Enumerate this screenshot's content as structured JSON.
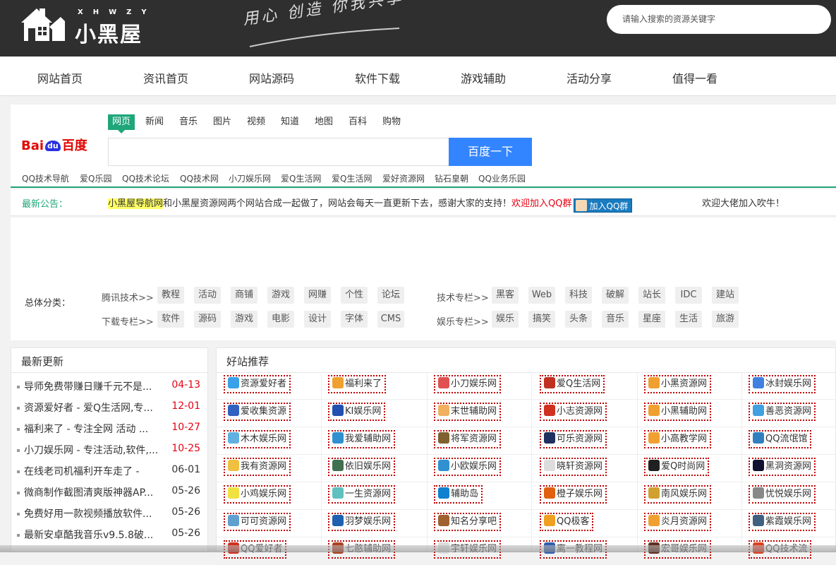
{
  "header": {
    "logo_letters": "XHWZY",
    "logo_text": "小黑屋",
    "slogan": "用心 创造 你我共享",
    "search_placeholder": "请输入搜索的资源关键字"
  },
  "nav": {
    "items": [
      "网站首页",
      "资讯首页",
      "网站源码",
      "软件下载",
      "游戏辅助",
      "活动分享",
      "值得一看"
    ]
  },
  "baidu": {
    "logo_bai": "Bai",
    "logo_du": "du",
    "logo_zh": "百度",
    "tabs": [
      "网页",
      "新闻",
      "音乐",
      "图片",
      "视频",
      "知道",
      "地图",
      "百科",
      "购物"
    ],
    "button": "百度一下",
    "links": [
      "QQ技术导航",
      "爱Q乐园",
      "QQ技术论坛",
      "QQ技术网",
      "小刀娱乐网",
      "爱Q生活网",
      "爱Q生活网",
      "爱好资源网",
      "钻石皇朝",
      "QQ业务乐园"
    ]
  },
  "notice": {
    "label": "最新公告：",
    "highlight": "小黑屋导航网",
    "text": "和小黑屋资源网两个网站合成一起做了，网站会每天一直更新下去，感谢大家的支持！",
    "red": "欢迎加入QQ群",
    "qq_button": "加入QQ群",
    "right": "欢迎大佬加入吹牛！"
  },
  "categories": {
    "label": "总体分类：",
    "groups": [
      {
        "name": "腾讯技术>>",
        "tags": [
          "教程",
          "活动",
          "商铺",
          "游戏",
          "网赚",
          "个性",
          "论坛"
        ]
      },
      {
        "name": "技术专栏>>",
        "tags": [
          "黑客",
          "Web",
          "科技",
          "破解",
          "站长",
          "IDC",
          "建站"
        ]
      },
      {
        "name": "下载专栏>>",
        "tags": [
          "软件",
          "源码",
          "游戏",
          "电影",
          "设计",
          "字体",
          "CMS"
        ]
      },
      {
        "name": "娱乐专栏>>",
        "tags": [
          "娱乐",
          "搞笑",
          "头条",
          "音乐",
          "星座",
          "生活",
          "旅游"
        ]
      }
    ]
  },
  "latest": {
    "title": "最新更新",
    "items": [
      {
        "title": "导师免费带赚日赚千元不是...",
        "date": "04-13",
        "recent": true
      },
      {
        "title": "资源爱好者 - 爱Q生活网,专...",
        "date": "12-01",
        "recent": true
      },
      {
        "title": "福利来了 - 专注全网 活动 ...",
        "date": "10-27",
        "recent": true
      },
      {
        "title": "小刀娱乐网 - 专注活动,软件,...",
        "date": "10-25",
        "recent": true
      },
      {
        "title": "在线老司机福利开车走了 -",
        "date": "06-01",
        "recent": false
      },
      {
        "title": "微商制作截图清爽版神器AP...",
        "date": "05-26",
        "recent": false
      },
      {
        "title": "免费好用一款视频播放软件...",
        "date": "05-26",
        "recent": false
      },
      {
        "title": "最新安卓酷我音乐v9.5.8破...",
        "date": "05-26",
        "recent": false
      }
    ]
  },
  "good": {
    "title": "好站推荐",
    "rows": [
      [
        "资源爱好者",
        "福利来了",
        "小刀娱乐网",
        "爱Q生活网",
        "小黑资源网",
        "冰封娱乐网"
      ],
      [
        "爱收集资源",
        "KI娱乐网",
        "末世辅助网",
        "小志资源网",
        "小黑辅助网",
        "善恶资源网"
      ],
      [
        "木木娱乐网",
        "我爱辅助网",
        "将军资源网",
        "可乐资源网",
        "小高教学网",
        "QQ流氓馆"
      ],
      [
        "我有资源网",
        "依旧娱乐网",
        "小欧娱乐网",
        "晓轩资源网",
        "爱Q时尚网",
        "黑洞资源网"
      ],
      [
        "小鸡娱乐网",
        "一生资源网",
        "辅助岛",
        "橙子娱乐网",
        "南风娱乐网",
        "忧悦娱乐网"
      ],
      [
        "可可资源网",
        "羽梦娱乐网",
        "知名分享吧",
        "QQ极客",
        "炎月资源网",
        "紫霞娱乐网"
      ],
      [
        "QQ爱好者",
        "七憨辅助网",
        "宇轩娱乐网",
        "离一教程网",
        "宏哥娱乐网",
        "QQ技术流"
      ]
    ],
    "icon_colors": [
      [
        "#3aa0e8",
        "#f0a030",
        "#e05050",
        "#c03020",
        "#f0a030",
        "#4080e0"
      ],
      [
        "#3060c0",
        "#2050b0",
        "#f0b060",
        "#d03020",
        "#f0a030",
        "#40a0e0"
      ],
      [
        "#60b0e0",
        "#3090d0",
        "#806030",
        "#203060",
        "#f0a030",
        "#3080c0"
      ],
      [
        "#f0c040",
        "#407050",
        "#3090d0",
        "#dddddd",
        "#202020",
        "#101030"
      ],
      [
        "#f0e040",
        "#60c0c0",
        "#1080d0",
        "#e06010",
        "#d0a030",
        "#888888"
      ],
      [
        "#60a0d0",
        "#2060b0",
        "#a06030",
        "#f0a020",
        "#f0a030",
        "#406080"
      ],
      [
        "#d03020",
        "#b04020",
        "#dddddd",
        "#3060b0",
        "#603020",
        "#e04020"
      ]
    ]
  }
}
